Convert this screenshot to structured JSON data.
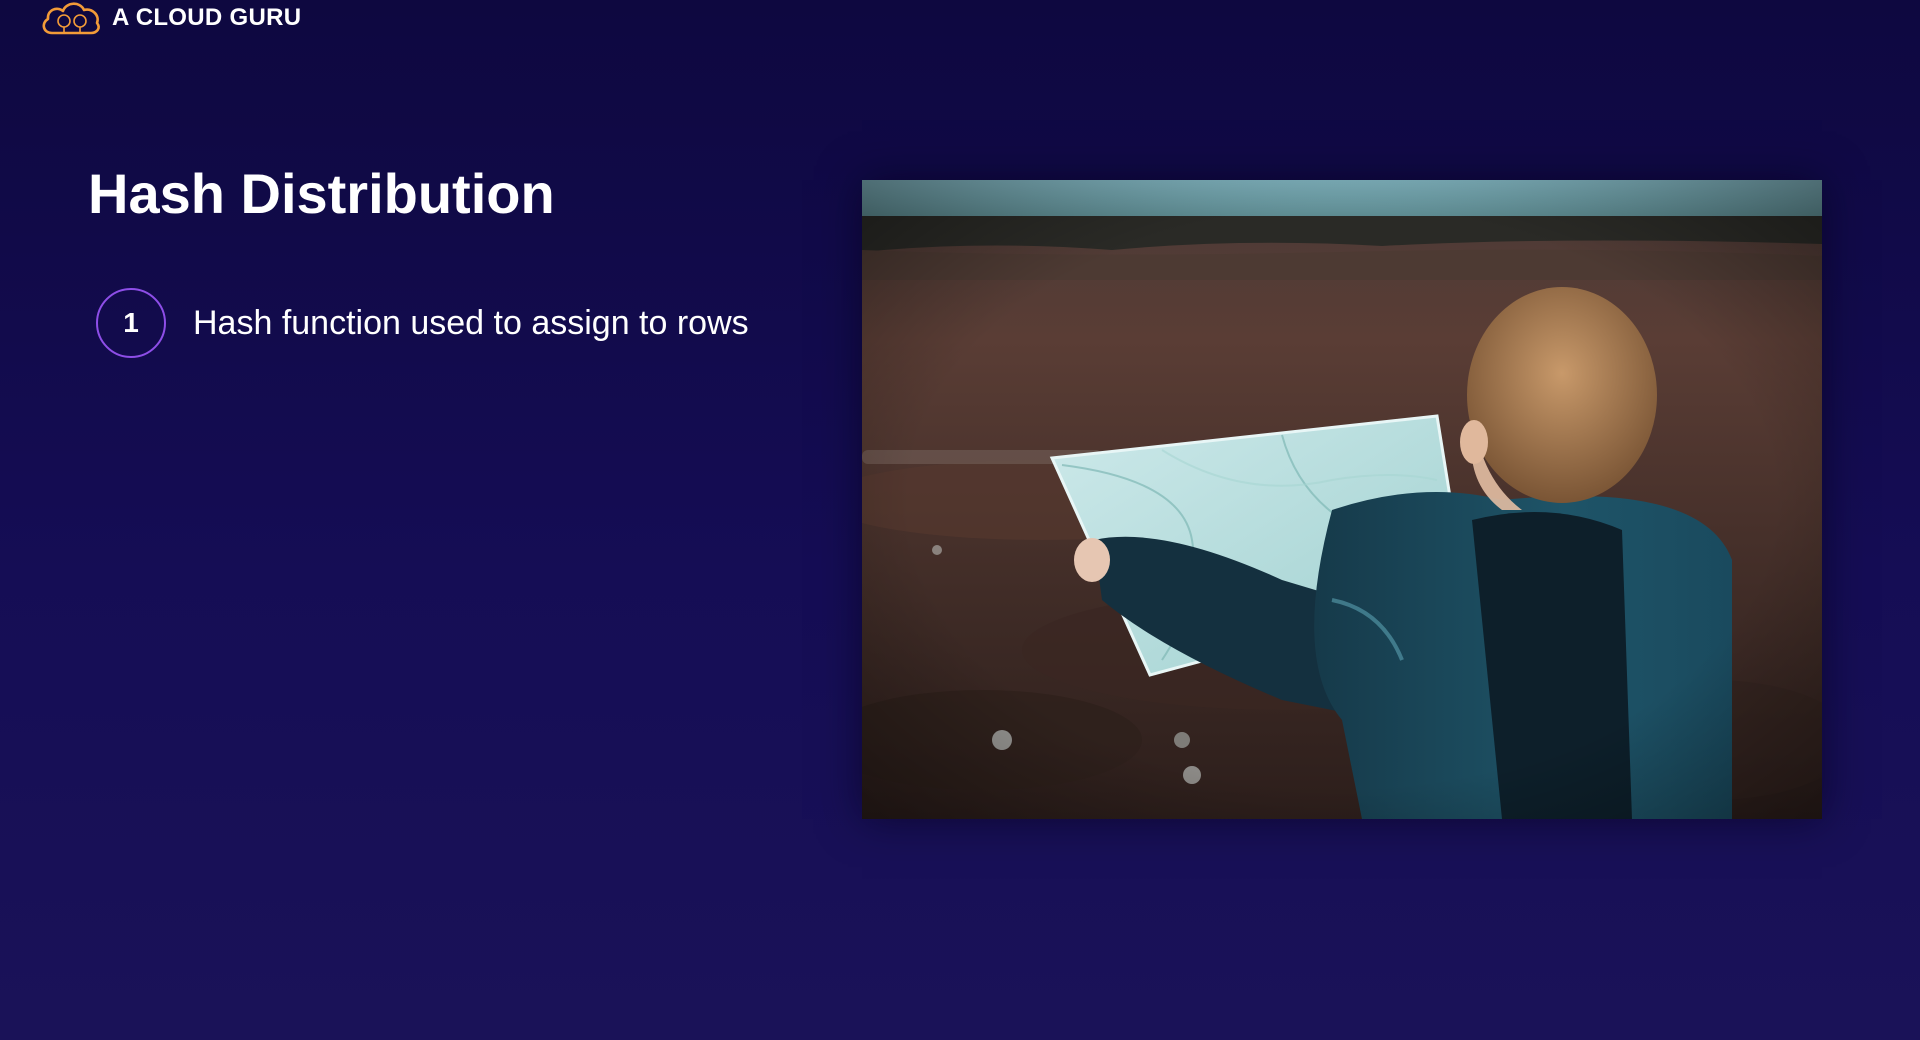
{
  "brand": {
    "name": "A CLOUD GURU",
    "icon": "cloud-logo-icon",
    "accent_color": "#f29b38"
  },
  "slide": {
    "title": "Hash Distribution",
    "points": [
      {
        "number": "1",
        "text": "Hash function used to assign to rows"
      }
    ],
    "circle_color": "#8e4ee8"
  },
  "image": {
    "subject": "child-reading-map-photo"
  }
}
